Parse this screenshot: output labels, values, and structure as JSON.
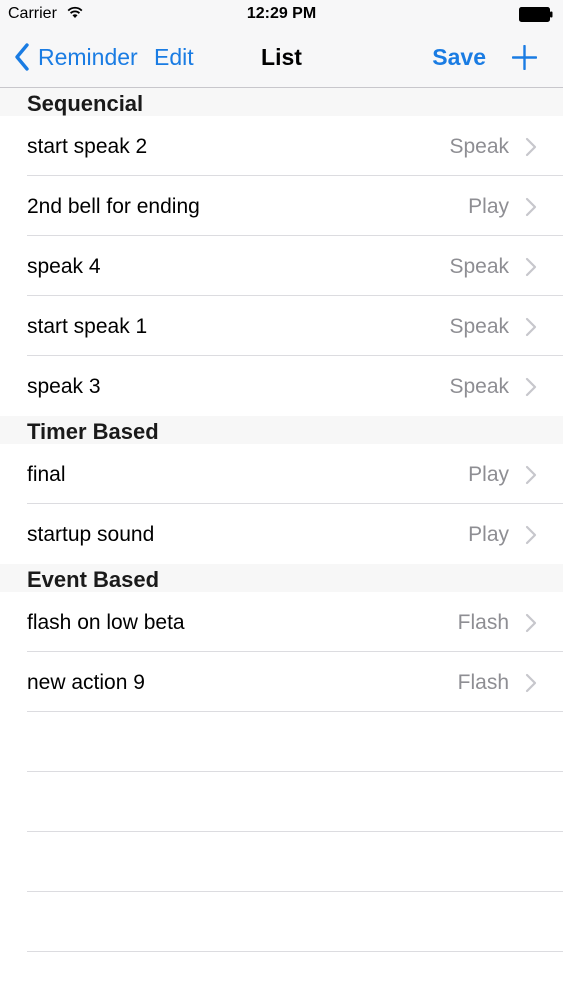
{
  "status_bar": {
    "carrier": "Carrier",
    "time": "12:29 PM"
  },
  "nav": {
    "back_label": "Reminder",
    "edit_label": "Edit",
    "title": "List",
    "save_label": "Save",
    "accent_color": "#1a7ce3"
  },
  "sections": [
    {
      "header": "Sequencial",
      "rows": [
        {
          "title": "start speak 2",
          "detail": "Speak"
        },
        {
          "title": "2nd bell for ending",
          "detail": "Play"
        },
        {
          "title": "speak 4",
          "detail": "Speak"
        },
        {
          "title": "start speak 1",
          "detail": "Speak"
        },
        {
          "title": "speak 3",
          "detail": "Speak"
        }
      ]
    },
    {
      "header": "Timer Based",
      "rows": [
        {
          "title": "final",
          "detail": "Play"
        },
        {
          "title": "startup sound",
          "detail": "Play"
        }
      ]
    },
    {
      "header": "Event Based",
      "rows": [
        {
          "title": "flash on low beta",
          "detail": "Flash"
        },
        {
          "title": "new action 9",
          "detail": "Flash"
        }
      ]
    }
  ]
}
